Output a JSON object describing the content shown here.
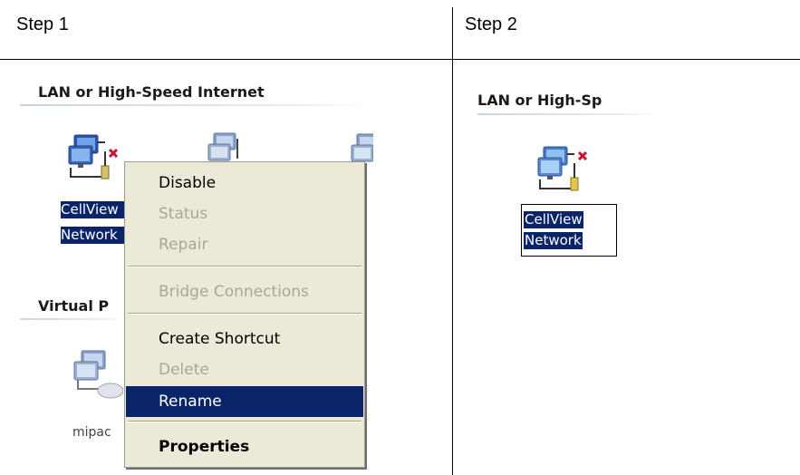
{
  "headers": {
    "step1": "Step 1",
    "step2": "Step 2"
  },
  "step1": {
    "group_title": "LAN or High-Speed Internet",
    "icon_label_line1": "CellView",
    "icon_label_line2": "Network",
    "virtual_group_title": "Virtual P",
    "mipad_label": "mipac",
    "context_menu": {
      "items": [
        {
          "label": "Disable",
          "state": "enabled"
        },
        {
          "label": "Status",
          "state": "disabled"
        },
        {
          "label": "Repair",
          "state": "disabled"
        },
        {
          "label": "Bridge Connections",
          "state": "disabled"
        },
        {
          "label": "Create Shortcut",
          "state": "enabled"
        },
        {
          "label": "Delete",
          "state": "disabled"
        },
        {
          "label": "Rename",
          "state": "highlighted"
        },
        {
          "label": "Properties",
          "state": "bold"
        }
      ]
    }
  },
  "step2": {
    "group_title": "LAN or High-Sp",
    "rename_line1": "CellView",
    "rename_line2": "Network"
  },
  "colors": {
    "selection": "#0a246a",
    "menu_bg": "#ece9d8",
    "disabled_text": "#a8a59c",
    "disconnect_x": "#c8102e"
  },
  "icons": [
    "network-connection-icon",
    "network-connection-icon",
    "network-connection-icon",
    "network-connection-icon",
    "network-connection-icon"
  ]
}
